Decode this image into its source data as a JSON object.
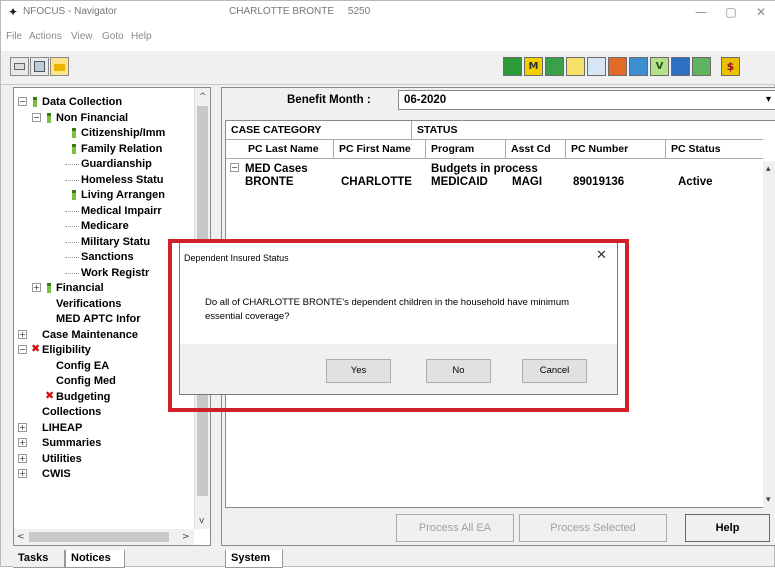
{
  "window": {
    "app_title": "NFOCUS - Navigator",
    "case_title": "CHARLOTTE BRONTE",
    "case_number": "5250",
    "controls": [
      "—",
      "▢",
      "✕"
    ]
  },
  "menu": [
    "File",
    "Actions",
    "View",
    "Goto",
    "Help"
  ],
  "toolbar": {
    "left_icons": [
      "open-icon",
      "save-icon",
      "folder-icon"
    ],
    "right_icons": [
      "green-m-icon",
      "m-icon",
      "people-icon",
      "note-icon",
      "chart-icon",
      "group-icon",
      "monitor-icon",
      "v-icon",
      "grid-icon",
      "bars-icon",
      "dollar-icon"
    ]
  },
  "tree": {
    "items": [
      {
        "label": "Data Collection",
        "level": 0,
        "icon": "leaf",
        "expander": "−"
      },
      {
        "label": "Non Financial",
        "level": 1,
        "icon": "leaf",
        "expander": "−"
      },
      {
        "label": "Citizenship/Imm",
        "level": 2,
        "icon": "leaf"
      },
      {
        "label": "Family Relation",
        "level": 2,
        "icon": "leaf"
      },
      {
        "label": "Guardianship",
        "level": 2
      },
      {
        "label": "Homeless Statu",
        "level": 2
      },
      {
        "label": "Living Arrangen",
        "level": 2,
        "icon": "leaf"
      },
      {
        "label": "Medical Impairr",
        "level": 2
      },
      {
        "label": "Medicare",
        "level": 2
      },
      {
        "label": "Military Statu",
        "level": 2
      },
      {
        "label": "Sanctions",
        "level": 2
      },
      {
        "label": "Work Registr",
        "level": 2
      },
      {
        "label": "Financial",
        "level": 1,
        "icon": "leaf",
        "expander": "+"
      },
      {
        "label": "Verifications",
        "level": 1
      },
      {
        "label": "MED APTC Infor",
        "level": 1
      },
      {
        "label": "Case Maintenance",
        "level": 0,
        "expander": "+"
      },
      {
        "label": "Eligibility",
        "level": 0,
        "icon": "x",
        "expander": "−"
      },
      {
        "label": "Config EA",
        "level": 1
      },
      {
        "label": "Config Med",
        "level": 1
      },
      {
        "label": "Budgeting",
        "level": 1,
        "icon": "x"
      },
      {
        "label": "Collections",
        "level": 0
      },
      {
        "label": "LIHEAP",
        "level": 0,
        "expander": "+"
      },
      {
        "label": "Summaries",
        "level": 0,
        "expander": "+"
      },
      {
        "label": "Utilities",
        "level": 0,
        "expander": "+"
      },
      {
        "label": "CWIS",
        "level": 0,
        "expander": "+"
      }
    ],
    "tabs": [
      "Tasks",
      "Notices"
    ]
  },
  "benefit": {
    "label": "Benefit Month :",
    "value": "06-2020"
  },
  "grid": {
    "top_headers": [
      "CASE CATEGORY",
      "STATUS"
    ],
    "columns": [
      "PC Last Name",
      "PC First Name",
      "Program",
      "Asst Cd",
      "PC Number",
      "PC Status"
    ],
    "group": {
      "name": "MED Cases",
      "status": "Budgets in process"
    },
    "rows": [
      {
        "last": "BRONTE",
        "first": "CHARLOTTE",
        "program": "MEDICAID",
        "asst": "MAGI",
        "number": "89019136",
        "status": "Active"
      }
    ]
  },
  "buttons": {
    "process_all": "Process All EA",
    "process_selected": "Process Selected",
    "help": "Help"
  },
  "bottom_tab": "System",
  "dialog": {
    "title": "Dependent Insured Status",
    "message": "Do all of CHARLOTTE BRONTE's dependent children in the household have minimum essential coverage?",
    "yes": "Yes",
    "no": "No",
    "cancel": "Cancel"
  },
  "colors": {
    "highlight": "#d0202a",
    "leaf_green": "#7ac142",
    "x_red": "#d01010"
  }
}
